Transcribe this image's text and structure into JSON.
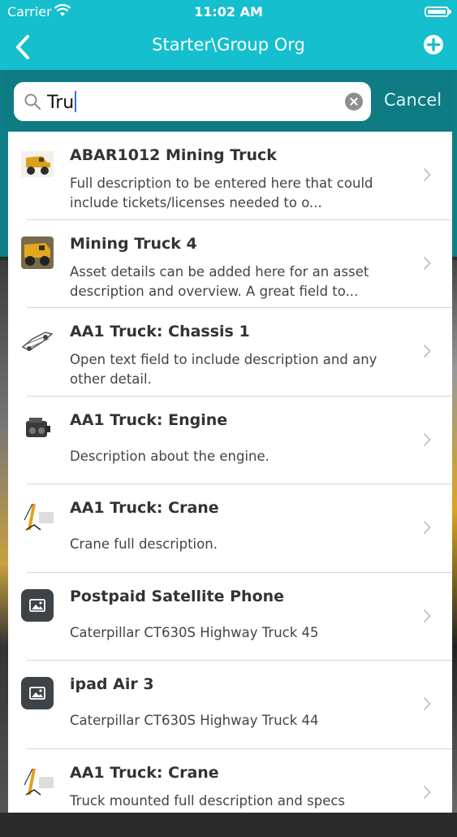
{
  "status": {
    "carrier": "Carrier",
    "time": "11:02 AM"
  },
  "nav": {
    "title": "Starter\\Group Org"
  },
  "search": {
    "value": "Tru",
    "cancel_label": "Cancel"
  },
  "items": [
    {
      "name": "ABAR1012 Mining Truck",
      "description": "Full description to be entered here that could include tickets/licenses needed to o...",
      "thumb": "mining-truck-photo"
    },
    {
      "name": "Mining Truck 4",
      "description": "Asset details can be added here for an asset description and overview.  A great field to...",
      "thumb": "mining-truck-photo"
    },
    {
      "name": "AA1 Truck: Chassis 1",
      "description": "Open text field to include description and any other detail.",
      "thumb": "chassis-photo"
    },
    {
      "name": "AA1 Truck: Engine",
      "description": "Description about the engine.",
      "thumb": "engine-photo"
    },
    {
      "name": "AA1 Truck: Crane",
      "description": "Crane full description.",
      "thumb": "crane-photo"
    },
    {
      "name": "Postpaid Satellite Phone",
      "description": "Caterpillar CT630S Highway Truck 45",
      "thumb": "image-placeholder-icon"
    },
    {
      "name": "ipad Air 3",
      "description": "Caterpillar CT630S Highway Truck 44",
      "thumb": "image-placeholder-icon"
    },
    {
      "name": "AA1 Truck: Crane",
      "description": "Truck mounted full description and specs",
      "thumb": "crane-photo"
    }
  ],
  "colors": {
    "nav": "#15bfcd",
    "search_bar": "#0f7b83"
  }
}
